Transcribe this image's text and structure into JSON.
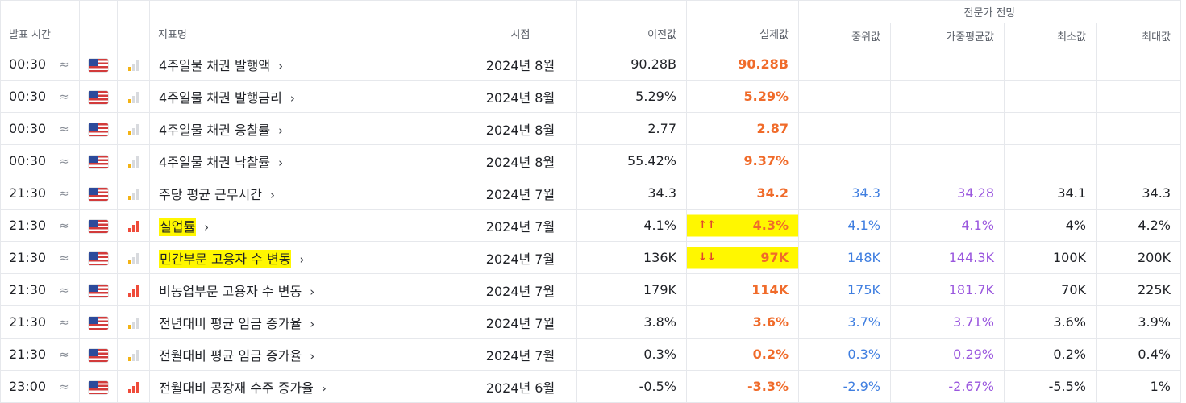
{
  "header": {
    "release_time": "발표 시간",
    "indicator_name": "지표명",
    "period": "시점",
    "previous": "이전값",
    "actual": "실제값",
    "expert_group": "전문가 전망",
    "median": "중위값",
    "weighted_avg": "가중평균값",
    "min": "최소값",
    "max": "최대값"
  },
  "rows": [
    {
      "time": "00:30",
      "approx": "≈",
      "importance": "low",
      "name": "4주일물 채권 발행액",
      "period": "2024년 8월",
      "previous": "90.28B",
      "actual": "90.28B",
      "median": "",
      "weighted": "",
      "min": "",
      "max": ""
    },
    {
      "time": "00:30",
      "approx": "≈",
      "importance": "low",
      "name": "4주일물 채권 발행금리",
      "period": "2024년 8월",
      "previous": "5.29%",
      "actual": "5.29%",
      "median": "",
      "weighted": "",
      "min": "",
      "max": ""
    },
    {
      "time": "00:30",
      "approx": "≈",
      "importance": "low",
      "name": "4주일물 채권 응찰률",
      "period": "2024년 8월",
      "previous": "2.77",
      "actual": "2.87",
      "median": "",
      "weighted": "",
      "min": "",
      "max": ""
    },
    {
      "time": "00:30",
      "approx": "≈",
      "importance": "low",
      "name": "4주일물 채권 낙찰률",
      "period": "2024년 8월",
      "previous": "55.42%",
      "actual": "9.37%",
      "median": "",
      "weighted": "",
      "min": "",
      "max": ""
    },
    {
      "time": "21:30",
      "approx": "≈",
      "importance": "low",
      "name": "주당 평균 근무시간",
      "period": "2024년 7월",
      "previous": "34.3",
      "actual": "34.2",
      "median": "34.3",
      "weighted": "34.28",
      "min": "34.1",
      "max": "34.3"
    },
    {
      "time": "21:30",
      "approx": "≈",
      "importance": "high",
      "name": "실업률",
      "period": "2024년 7월",
      "previous": "4.1%",
      "actual": "4.3%",
      "surprise": "↑↑",
      "median": "4.1%",
      "weighted": "4.1%",
      "min": "4%",
      "max": "4.2%"
    },
    {
      "time": "21:30",
      "approx": "≈",
      "importance": "low",
      "name": "민간부문 고용자 수 변동",
      "period": "2024년 7월",
      "previous": "136K",
      "actual": "97K",
      "surprise": "↓↓",
      "median": "148K",
      "weighted": "144.3K",
      "min": "100K",
      "max": "200K"
    },
    {
      "time": "21:30",
      "approx": "≈",
      "importance": "high",
      "name": "비농업부문 고용자 수 변동",
      "period": "2024년 7월",
      "previous": "179K",
      "actual": "114K",
      "median": "175K",
      "weighted": "181.7K",
      "min": "70K",
      "max": "225K"
    },
    {
      "time": "21:30",
      "approx": "≈",
      "importance": "low",
      "name": "전년대비 평균 임금 증가율",
      "period": "2024년 7월",
      "previous": "3.8%",
      "actual": "3.6%",
      "median": "3.7%",
      "weighted": "3.71%",
      "min": "3.6%",
      "max": "3.9%"
    },
    {
      "time": "21:30",
      "approx": "≈",
      "importance": "low",
      "name": "전월대비 평균 임금 증가율",
      "period": "2024년 7월",
      "previous": "0.3%",
      "actual": "0.2%",
      "median": "0.3%",
      "weighted": "0.29%",
      "min": "0.2%",
      "max": "0.4%"
    },
    {
      "time": "23:00",
      "approx": "≈",
      "importance": "high",
      "name": "전월대비 공장재 수주 증가율",
      "period": "2024년 6월",
      "previous": "-0.5%",
      "actual": "-3.3%",
      "median": "-2.9%",
      "weighted": "-2.67%",
      "min": "-5.5%",
      "max": "1%"
    }
  ],
  "chevron": "›",
  "colors": {
    "actual": "#f06b2a",
    "median": "#3f7ee0",
    "weighted": "#9a57de",
    "highlight": "#fff700",
    "high_importance": "#ef4b3a",
    "low_importance": "#f3b315"
  }
}
